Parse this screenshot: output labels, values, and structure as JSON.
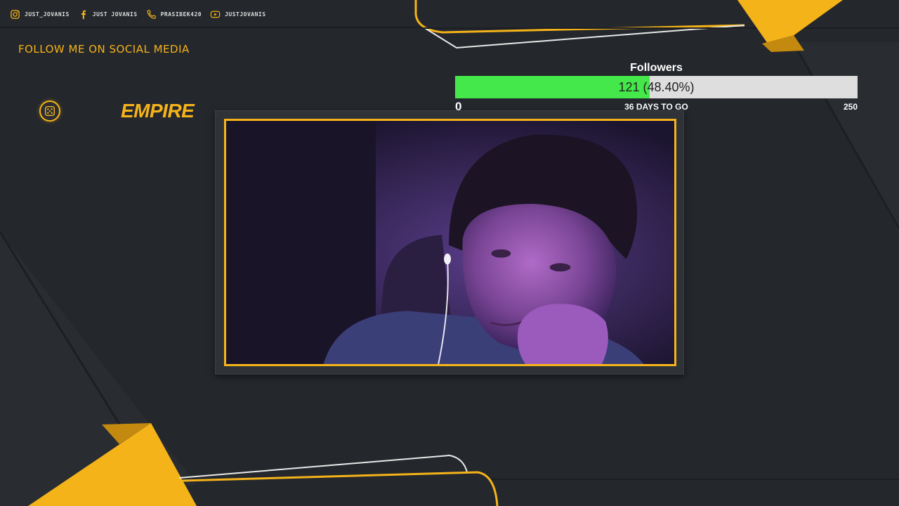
{
  "social": [
    {
      "icon": "instagram-icon",
      "label": "JUST_JOVANIS"
    },
    {
      "icon": "facebook-icon",
      "label": "JUST JOVANIS"
    },
    {
      "icon": "phone-icon",
      "label": "PRASIBEK420"
    },
    {
      "icon": "youtube-icon",
      "label": "JUSTJOVANIS"
    }
  ],
  "follow_heading": "FOLLOW ME ON SOCIAL MEDIA",
  "logo": {
    "text": "EMPIRE"
  },
  "goal": {
    "title": "Followers",
    "value_text": "121 (48.40%)",
    "progress_fraction": 0.484,
    "min": "0",
    "max": "250",
    "days_left": "36 DAYS TO GO"
  },
  "colors": {
    "accent": "#f5b31a",
    "background": "#24272c",
    "progress_fill": "#45e84a",
    "progress_track": "#dedede"
  }
}
